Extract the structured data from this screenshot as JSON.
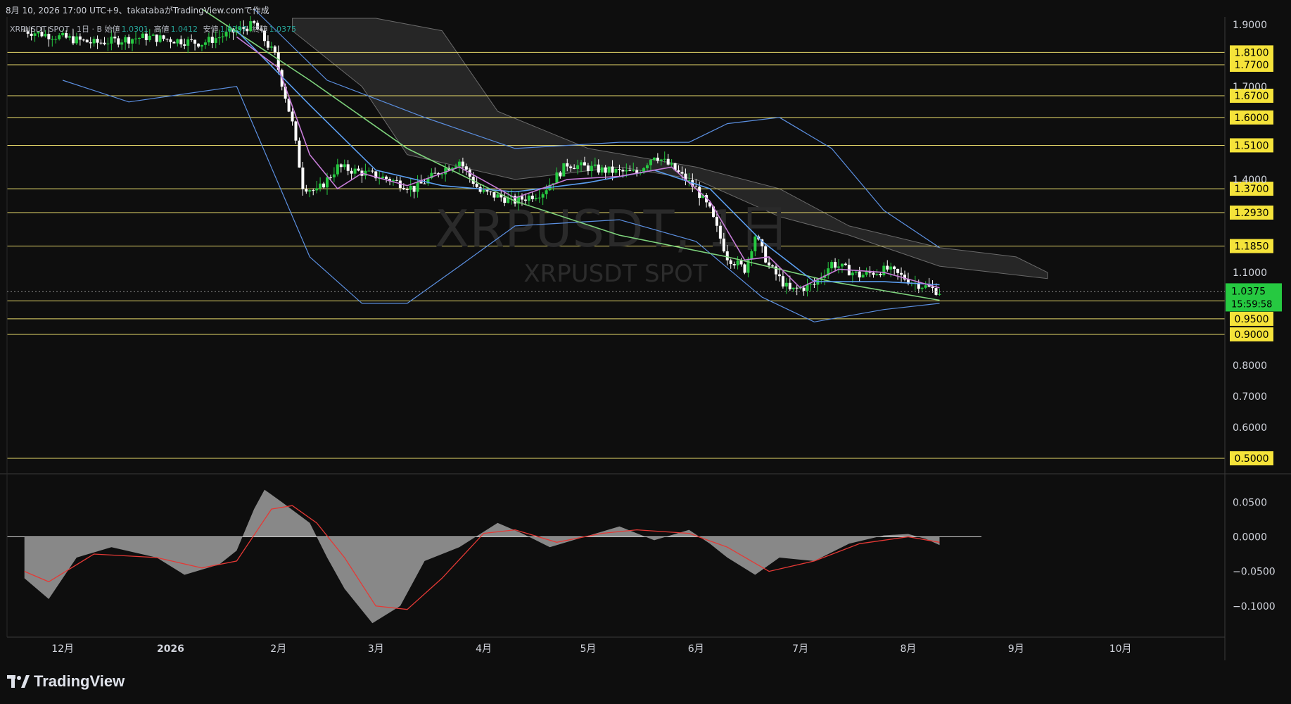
{
  "caption": "8月 10, 2026 17:00 UTC+9、takatabaがTradingView.comで作成",
  "legend": {
    "symbol": "XRPUSDT SPOT · 1日 · B",
    "open_label": "始値",
    "open": "1.0301",
    "high_label": "高値",
    "high": "1.0412",
    "low_label": "安値",
    "low": "1.0297",
    "close_label": "終値",
    "close": "1.0375"
  },
  "watermark": {
    "main": "XRPUSDT, 1日",
    "sub": "XRPUSDT SPOT"
  },
  "brand": "TradingView",
  "price_tag": {
    "price": "1.0375",
    "countdown": "15:59:58",
    "value": 1.0375,
    "color": "#26c941"
  },
  "colors": {
    "bull": "#26c941",
    "bear": "#ffffff",
    "background": "#0e0e0e",
    "hline": "#e6d86a",
    "ma_fast": "#c77dd8",
    "ma_mid": "#5b9ef0",
    "ma_slow": "#7ed37c",
    "bb": "#5b8fe0",
    "cloud": "#3a3a3a",
    "macd_hist": "#9e9e9e",
    "macd_signal": "#e53935"
  },
  "chart_data": [
    {
      "type": "candlestick",
      "ylim": [
        0.45,
        1.92
      ],
      "y_ticks": [
        "1.9000",
        "1.7000",
        "1.4000",
        "1.1000",
        "0.8000",
        "0.7000",
        "0.6000"
      ],
      "y_tick_values": [
        1.9,
        1.7,
        1.4,
        1.1,
        0.8,
        0.7,
        0.6
      ],
      "x_labels": [
        "12月",
        "2026",
        "2月",
        "3月",
        "4月",
        "5月",
        "6月",
        "7月",
        "8月",
        "9月",
        "10月"
      ],
      "x_dates": [
        "2025-12-01",
        "2026-01-01",
        "2026-02-01",
        "2026-03-01",
        "2026-04-01",
        "2026-05-01",
        "2026-06-01",
        "2026-07-01",
        "2026-08-01",
        "2026-09-01",
        "2026-10-01"
      ],
      "levels": [
        {
          "label": "1.8100",
          "value": 1.81
        },
        {
          "label": "1.7700",
          "value": 1.77
        },
        {
          "label": "1.6700",
          "value": 1.67
        },
        {
          "label": "1.6000",
          "value": 1.6
        },
        {
          "label": "1.5100",
          "value": 1.51
        },
        {
          "label": "1.3700",
          "value": 1.37
        },
        {
          "label": "1.2930",
          "value": 1.293
        },
        {
          "label": "1.1850",
          "value": 1.185
        },
        {
          "label": "1.0080",
          "value": 1.008
        },
        {
          "label": "0.9500",
          "value": 0.95
        },
        {
          "label": "0.9000",
          "value": 0.9
        },
        {
          "label": "0.5000",
          "value": 0.5
        }
      ],
      "price_path": [
        {
          "d": "2025-11-20",
          "c": 1.88
        },
        {
          "d": "2025-12-10",
          "c": 1.84
        },
        {
          "d": "2025-12-25",
          "c": 1.86
        },
        {
          "d": "2026-01-10",
          "c": 1.84
        },
        {
          "d": "2026-01-25",
          "c": 1.9
        },
        {
          "d": "2026-01-31",
          "c": 1.8
        },
        {
          "d": "2026-02-05",
          "c": 1.58
        },
        {
          "d": "2026-02-08",
          "c": 1.38
        },
        {
          "d": "2026-02-12",
          "c": 1.36
        },
        {
          "d": "2026-02-18",
          "c": 1.44
        },
        {
          "d": "2026-02-26",
          "c": 1.42
        },
        {
          "d": "2026-03-05",
          "c": 1.4
        },
        {
          "d": "2026-03-12",
          "c": 1.37
        },
        {
          "d": "2026-03-20",
          "c": 1.43
        },
        {
          "d": "2026-03-25",
          "c": 1.46
        },
        {
          "d": "2026-03-31",
          "c": 1.36
        },
        {
          "d": "2026-04-10",
          "c": 1.33
        },
        {
          "d": "2026-04-18",
          "c": 1.36
        },
        {
          "d": "2026-04-25",
          "c": 1.45
        },
        {
          "d": "2026-05-05",
          "c": 1.43
        },
        {
          "d": "2026-05-15",
          "c": 1.42
        },
        {
          "d": "2026-05-20",
          "c": 1.48
        },
        {
          "d": "2026-05-25",
          "c": 1.44
        },
        {
          "d": "2026-06-01",
          "c": 1.37
        },
        {
          "d": "2026-06-05",
          "c": 1.3
        },
        {
          "d": "2026-06-10",
          "c": 1.15
        },
        {
          "d": "2026-06-15",
          "c": 1.11
        },
        {
          "d": "2026-06-18",
          "c": 1.22
        },
        {
          "d": "2026-06-22",
          "c": 1.12
        },
        {
          "d": "2026-06-28",
          "c": 1.04
        },
        {
          "d": "2026-07-05",
          "c": 1.06
        },
        {
          "d": "2026-07-10",
          "c": 1.13
        },
        {
          "d": "2026-07-18",
          "c": 1.09
        },
        {
          "d": "2026-07-26",
          "c": 1.11
        },
        {
          "d": "2026-08-02",
          "c": 1.07
        },
        {
          "d": "2026-08-10",
          "c": 1.0375
        }
      ],
      "sma_fast": [
        {
          "d": "2026-01-20",
          "v": 1.86
        },
        {
          "d": "2026-02-01",
          "v": 1.76
        },
        {
          "d": "2026-02-10",
          "v": 1.48
        },
        {
          "d": "2026-02-18",
          "v": 1.37
        },
        {
          "d": "2026-02-25",
          "v": 1.42
        },
        {
          "d": "2026-03-10",
          "v": 1.38
        },
        {
          "d": "2026-03-25",
          "v": 1.44
        },
        {
          "d": "2026-04-10",
          "v": 1.34
        },
        {
          "d": "2026-04-25",
          "v": 1.4
        },
        {
          "d": "2026-05-10",
          "v": 1.41
        },
        {
          "d": "2026-05-25",
          "v": 1.44
        },
        {
          "d": "2026-06-05",
          "v": 1.33
        },
        {
          "d": "2026-06-15",
          "v": 1.14
        },
        {
          "d": "2026-06-22",
          "v": 1.15
        },
        {
          "d": "2026-07-01",
          "v": 1.05
        },
        {
          "d": "2026-07-12",
          "v": 1.11
        },
        {
          "d": "2026-07-25",
          "v": 1.1
        },
        {
          "d": "2026-08-10",
          "v": 1.05
        }
      ],
      "sma_mid": [
        {
          "d": "2026-01-20",
          "v": 1.88
        },
        {
          "d": "2026-02-10",
          "v": 1.64
        },
        {
          "d": "2026-03-01",
          "v": 1.43
        },
        {
          "d": "2026-03-20",
          "v": 1.38
        },
        {
          "d": "2026-04-10",
          "v": 1.36
        },
        {
          "d": "2026-05-01",
          "v": 1.39
        },
        {
          "d": "2026-05-20",
          "v": 1.43
        },
        {
          "d": "2026-06-05",
          "v": 1.37
        },
        {
          "d": "2026-06-20",
          "v": 1.2
        },
        {
          "d": "2026-07-05",
          "v": 1.07
        },
        {
          "d": "2026-07-25",
          "v": 1.07
        },
        {
          "d": "2026-08-10",
          "v": 1.06
        }
      ],
      "sma_slow": [
        {
          "d": "2026-01-10",
          "v": 1.95
        },
        {
          "d": "2026-02-10",
          "v": 1.72
        },
        {
          "d": "2026-03-10",
          "v": 1.5
        },
        {
          "d": "2026-04-10",
          "v": 1.33
        },
        {
          "d": "2026-05-10",
          "v": 1.22
        },
        {
          "d": "2026-06-10",
          "v": 1.15
        },
        {
          "d": "2026-07-10",
          "v": 1.07
        },
        {
          "d": "2026-08-10",
          "v": 1.01
        }
      ],
      "bb_upper": [
        {
          "d": "2026-01-25",
          "v": 1.95
        },
        {
          "d": "2026-02-15",
          "v": 1.72
        },
        {
          "d": "2026-03-15",
          "v": 1.6
        },
        {
          "d": "2026-04-10",
          "v": 1.5
        },
        {
          "d": "2026-05-10",
          "v": 1.52
        },
        {
          "d": "2026-05-30",
          "v": 1.52
        },
        {
          "d": "2026-06-10",
          "v": 1.58
        },
        {
          "d": "2026-06-25",
          "v": 1.6
        },
        {
          "d": "2026-07-10",
          "v": 1.5
        },
        {
          "d": "2026-07-25",
          "v": 1.3
        },
        {
          "d": "2026-08-10",
          "v": 1.18
        }
      ],
      "bb_lower": [
        {
          "d": "2025-12-01",
          "v": 1.72
        },
        {
          "d": "2025-12-20",
          "v": 1.65
        },
        {
          "d": "2026-01-20",
          "v": 1.7
        },
        {
          "d": "2026-02-10",
          "v": 1.15
        },
        {
          "d": "2026-02-25",
          "v": 1.0
        },
        {
          "d": "2026-03-10",
          "v": 1.0
        },
        {
          "d": "2026-03-25",
          "v": 1.12
        },
        {
          "d": "2026-04-10",
          "v": 1.25
        },
        {
          "d": "2026-05-10",
          "v": 1.27
        },
        {
          "d": "2026-06-01",
          "v": 1.2
        },
        {
          "d": "2026-06-20",
          "v": 1.02
        },
        {
          "d": "2026-07-05",
          "v": 0.94
        },
        {
          "d": "2026-07-25",
          "v": 0.98
        },
        {
          "d": "2026-08-10",
          "v": 1.0
        }
      ],
      "cloud_top": [
        {
          "d": "2026-02-05",
          "v": 1.92
        },
        {
          "d": "2026-03-01",
          "v": 1.92
        },
        {
          "d": "2026-03-20",
          "v": 1.88
        },
        {
          "d": "2026-04-05",
          "v": 1.62
        },
        {
          "d": "2026-05-01",
          "v": 1.5
        },
        {
          "d": "2026-06-01",
          "v": 1.44
        },
        {
          "d": "2026-06-25",
          "v": 1.37
        },
        {
          "d": "2026-07-15",
          "v": 1.25
        },
        {
          "d": "2026-08-10",
          "v": 1.18
        },
        {
          "d": "2026-09-01",
          "v": 1.15
        },
        {
          "d": "2026-09-10",
          "v": 1.1
        }
      ],
      "cloud_bottom": [
        {
          "d": "2026-02-05",
          "v": 1.88
        },
        {
          "d": "2026-02-25",
          "v": 1.7
        },
        {
          "d": "2026-03-10",
          "v": 1.48
        },
        {
          "d": "2026-04-10",
          "v": 1.4
        },
        {
          "d": "2026-05-10",
          "v": 1.44
        },
        {
          "d": "2026-06-01",
          "v": 1.4
        },
        {
          "d": "2026-06-25",
          "v": 1.28
        },
        {
          "d": "2026-07-15",
          "v": 1.22
        },
        {
          "d": "2026-08-10",
          "v": 1.12
        },
        {
          "d": "2026-09-10",
          "v": 1.08
        }
      ]
    },
    {
      "type": "histogram",
      "ylim": [
        -0.145,
        0.09
      ],
      "y_ticks": [
        "0.0500",
        "0.0000",
        "−0.0500",
        "−0.1000"
      ],
      "y_tick_values": [
        0.05,
        0.0,
        -0.05,
        -0.1
      ],
      "histogram": [
        {
          "d": "2025-11-20",
          "v": -0.06
        },
        {
          "d": "2025-11-27",
          "v": -0.09
        },
        {
          "d": "2025-12-05",
          "v": -0.03
        },
        {
          "d": "2025-12-15",
          "v": -0.015
        },
        {
          "d": "2025-12-28",
          "v": -0.03
        },
        {
          "d": "2026-01-05",
          "v": -0.055
        },
        {
          "d": "2026-01-15",
          "v": -0.04
        },
        {
          "d": "2026-01-20",
          "v": -0.02
        },
        {
          "d": "2026-01-25",
          "v": 0.04
        },
        {
          "d": "2026-01-28",
          "v": 0.068
        },
        {
          "d": "2026-02-02",
          "v": 0.05
        },
        {
          "d": "2026-02-10",
          "v": 0.02
        },
        {
          "d": "2026-02-15",
          "v": -0.03
        },
        {
          "d": "2026-02-20",
          "v": -0.075
        },
        {
          "d": "2026-02-28",
          "v": -0.125
        },
        {
          "d": "2026-03-08",
          "v": -0.1
        },
        {
          "d": "2026-03-15",
          "v": -0.035
        },
        {
          "d": "2026-03-25",
          "v": -0.015
        },
        {
          "d": "2026-04-05",
          "v": 0.02
        },
        {
          "d": "2026-04-12",
          "v": 0.005
        },
        {
          "d": "2026-04-20",
          "v": -0.015
        },
        {
          "d": "2026-04-30",
          "v": 0.0
        },
        {
          "d": "2026-05-10",
          "v": 0.015
        },
        {
          "d": "2026-05-20",
          "v": -0.005
        },
        {
          "d": "2026-05-30",
          "v": 0.01
        },
        {
          "d": "2026-06-05",
          "v": -0.01
        },
        {
          "d": "2026-06-10",
          "v": -0.03
        },
        {
          "d": "2026-06-18",
          "v": -0.055
        },
        {
          "d": "2026-06-25",
          "v": -0.03
        },
        {
          "d": "2026-07-05",
          "v": -0.035
        },
        {
          "d": "2026-07-15",
          "v": -0.01
        },
        {
          "d": "2026-07-25",
          "v": 0.002
        },
        {
          "d": "2026-08-01",
          "v": 0.004
        },
        {
          "d": "2026-08-06",
          "v": -0.003
        },
        {
          "d": "2026-08-10",
          "v": -0.012
        }
      ],
      "signal": [
        {
          "d": "2025-11-20",
          "v": -0.05
        },
        {
          "d": "2025-11-27",
          "v": -0.065
        },
        {
          "d": "2025-12-10",
          "v": -0.025
        },
        {
          "d": "2025-12-28",
          "v": -0.03
        },
        {
          "d": "2026-01-10",
          "v": -0.045
        },
        {
          "d": "2026-01-20",
          "v": -0.035
        },
        {
          "d": "2026-01-30",
          "v": 0.04
        },
        {
          "d": "2026-02-05",
          "v": 0.045
        },
        {
          "d": "2026-02-12",
          "v": 0.02
        },
        {
          "d": "2026-02-20",
          "v": -0.03
        },
        {
          "d": "2026-03-01",
          "v": -0.1
        },
        {
          "d": "2026-03-10",
          "v": -0.105
        },
        {
          "d": "2026-03-20",
          "v": -0.06
        },
        {
          "d": "2026-04-01",
          "v": 0.005
        },
        {
          "d": "2026-04-10",
          "v": 0.01
        },
        {
          "d": "2026-04-22",
          "v": -0.008
        },
        {
          "d": "2026-05-05",
          "v": 0.005
        },
        {
          "d": "2026-05-15",
          "v": 0.01
        },
        {
          "d": "2026-05-30",
          "v": 0.005
        },
        {
          "d": "2026-06-10",
          "v": -0.015
        },
        {
          "d": "2026-06-22",
          "v": -0.05
        },
        {
          "d": "2026-07-05",
          "v": -0.035
        },
        {
          "d": "2026-07-18",
          "v": -0.01
        },
        {
          "d": "2026-08-01",
          "v": 0.0
        },
        {
          "d": "2026-08-10",
          "v": -0.008
        }
      ]
    }
  ]
}
